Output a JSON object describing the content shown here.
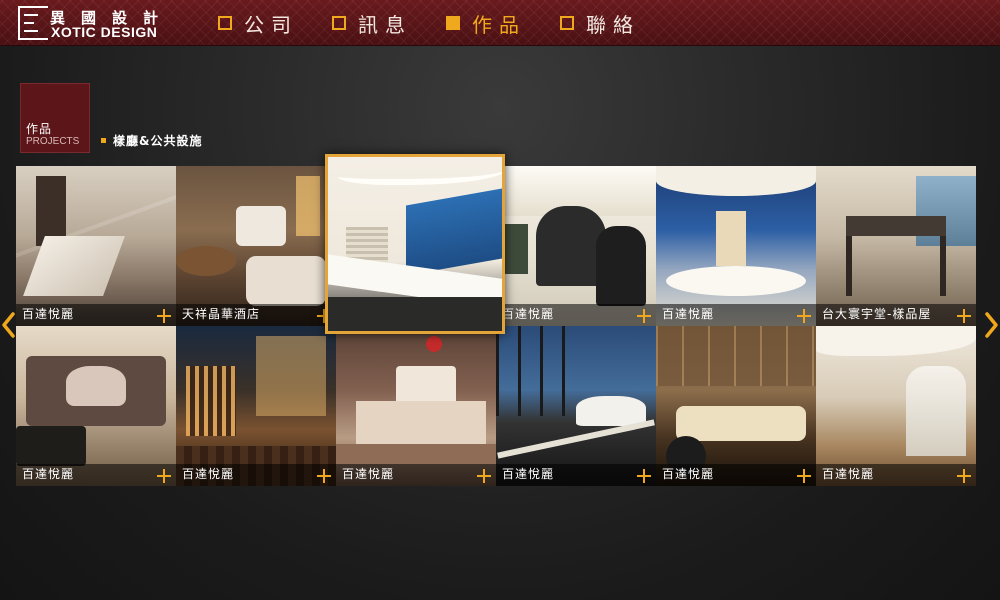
{
  "header": {
    "logo_cn": "異國設計",
    "logo_en": "XOTIC DESIGN",
    "nav": [
      {
        "label": "公司",
        "active": false
      },
      {
        "label": "訊息",
        "active": false
      },
      {
        "label": "作品",
        "active": true
      },
      {
        "label": "聯絡",
        "active": false
      }
    ]
  },
  "section": {
    "badge_cn": "作品",
    "badge_en": "PROJECTS",
    "breadcrumb": "樣廳&公共設施"
  },
  "gallery": {
    "tiles": [
      {
        "caption": "百達悅麗"
      },
      {
        "caption": "天祥晶華酒店"
      },
      {
        "caption": ""
      },
      {
        "caption": "百達悅麗"
      },
      {
        "caption": "百達悅麗"
      },
      {
        "caption": "台大寰宇堂-樣品屋"
      },
      {
        "caption": "百達悅麗"
      },
      {
        "caption": "百達悅麗"
      },
      {
        "caption": "百達悅麗"
      },
      {
        "caption": "百達悅麗"
      },
      {
        "caption": "百達悅麗"
      },
      {
        "caption": "百達悅麗"
      }
    ]
  },
  "colors": {
    "accent": "#f0a81c",
    "header_bg": "#5a1518",
    "badge_bg": "#5c1518"
  },
  "icons": {
    "prev": "chevron-left-icon",
    "next": "chevron-right-icon",
    "expand": "plus-icon"
  }
}
